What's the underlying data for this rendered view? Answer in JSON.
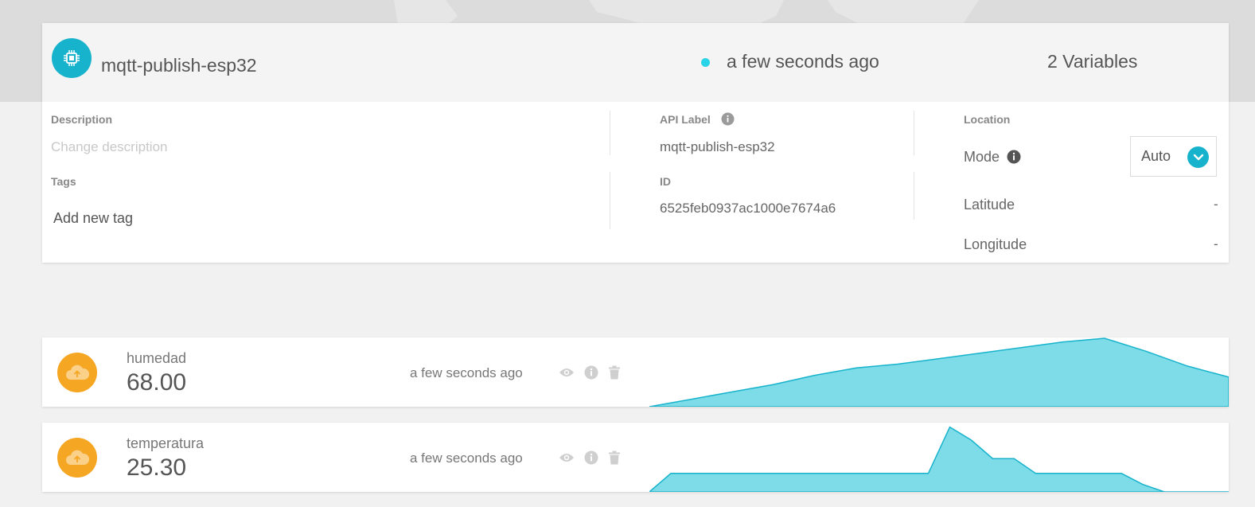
{
  "device": {
    "name": "mqtt-publish-esp32",
    "last_activity": "a few seconds ago",
    "variable_count": "2 Variables",
    "icon": "chip-icon",
    "accent_color": "#17b3cc",
    "status_color": "#2ad4e8"
  },
  "details": {
    "description_label": "Description",
    "description_placeholder": "Change description",
    "tags_label": "Tags",
    "add_tag": "Add new tag",
    "api_label_label": "API Label",
    "api_label_value": "mqtt-publish-esp32",
    "id_label": "ID",
    "id_value": "6525feb0937ac1000e7674a6",
    "location_label": "Location",
    "mode_label": "Mode",
    "mode_value": "Auto",
    "latitude_label": "Latitude",
    "latitude_value": "-",
    "longitude_label": "Longitude",
    "longitude_value": "-"
  },
  "variables": [
    {
      "name": "humedad",
      "value": "68.00",
      "time": "a few seconds ago",
      "icon": "cloud-upload-icon",
      "icon_color": "#f5a623",
      "sparkline": [
        0,
        4,
        8,
        12,
        17,
        21,
        23,
        26,
        29,
        32,
        35,
        37,
        30,
        22,
        16
      ],
      "actions": [
        "eye-icon",
        "info-icon",
        "trash-icon"
      ]
    },
    {
      "name": "temperatura",
      "value": "25.30",
      "time": "a few seconds ago",
      "icon": "cloud-upload-icon",
      "icon_color": "#f5a623",
      "sparkline": [
        0,
        10,
        10,
        10,
        10,
        10,
        10,
        10,
        10,
        10,
        10,
        10,
        10,
        10,
        35,
        28,
        18,
        18,
        10,
        10,
        10,
        10,
        10,
        4,
        0,
        0,
        0,
        0
      ],
      "actions": [
        "eye-icon",
        "info-icon",
        "trash-icon"
      ]
    }
  ],
  "chart_data": [
    {
      "type": "area",
      "series": [
        {
          "values": [
            0,
            4,
            8,
            12,
            17,
            21,
            23,
            26,
            29,
            32,
            35,
            37,
            30,
            22,
            16
          ]
        }
      ]
    },
    {
      "type": "area",
      "series": [
        {
          "values": [
            0,
            10,
            10,
            10,
            10,
            10,
            10,
            10,
            10,
            10,
            10,
            10,
            10,
            10,
            35,
            28,
            18,
            18,
            10,
            10,
            10,
            10,
            10,
            4,
            0,
            0,
            0,
            0
          ]
        }
      ]
    }
  ]
}
